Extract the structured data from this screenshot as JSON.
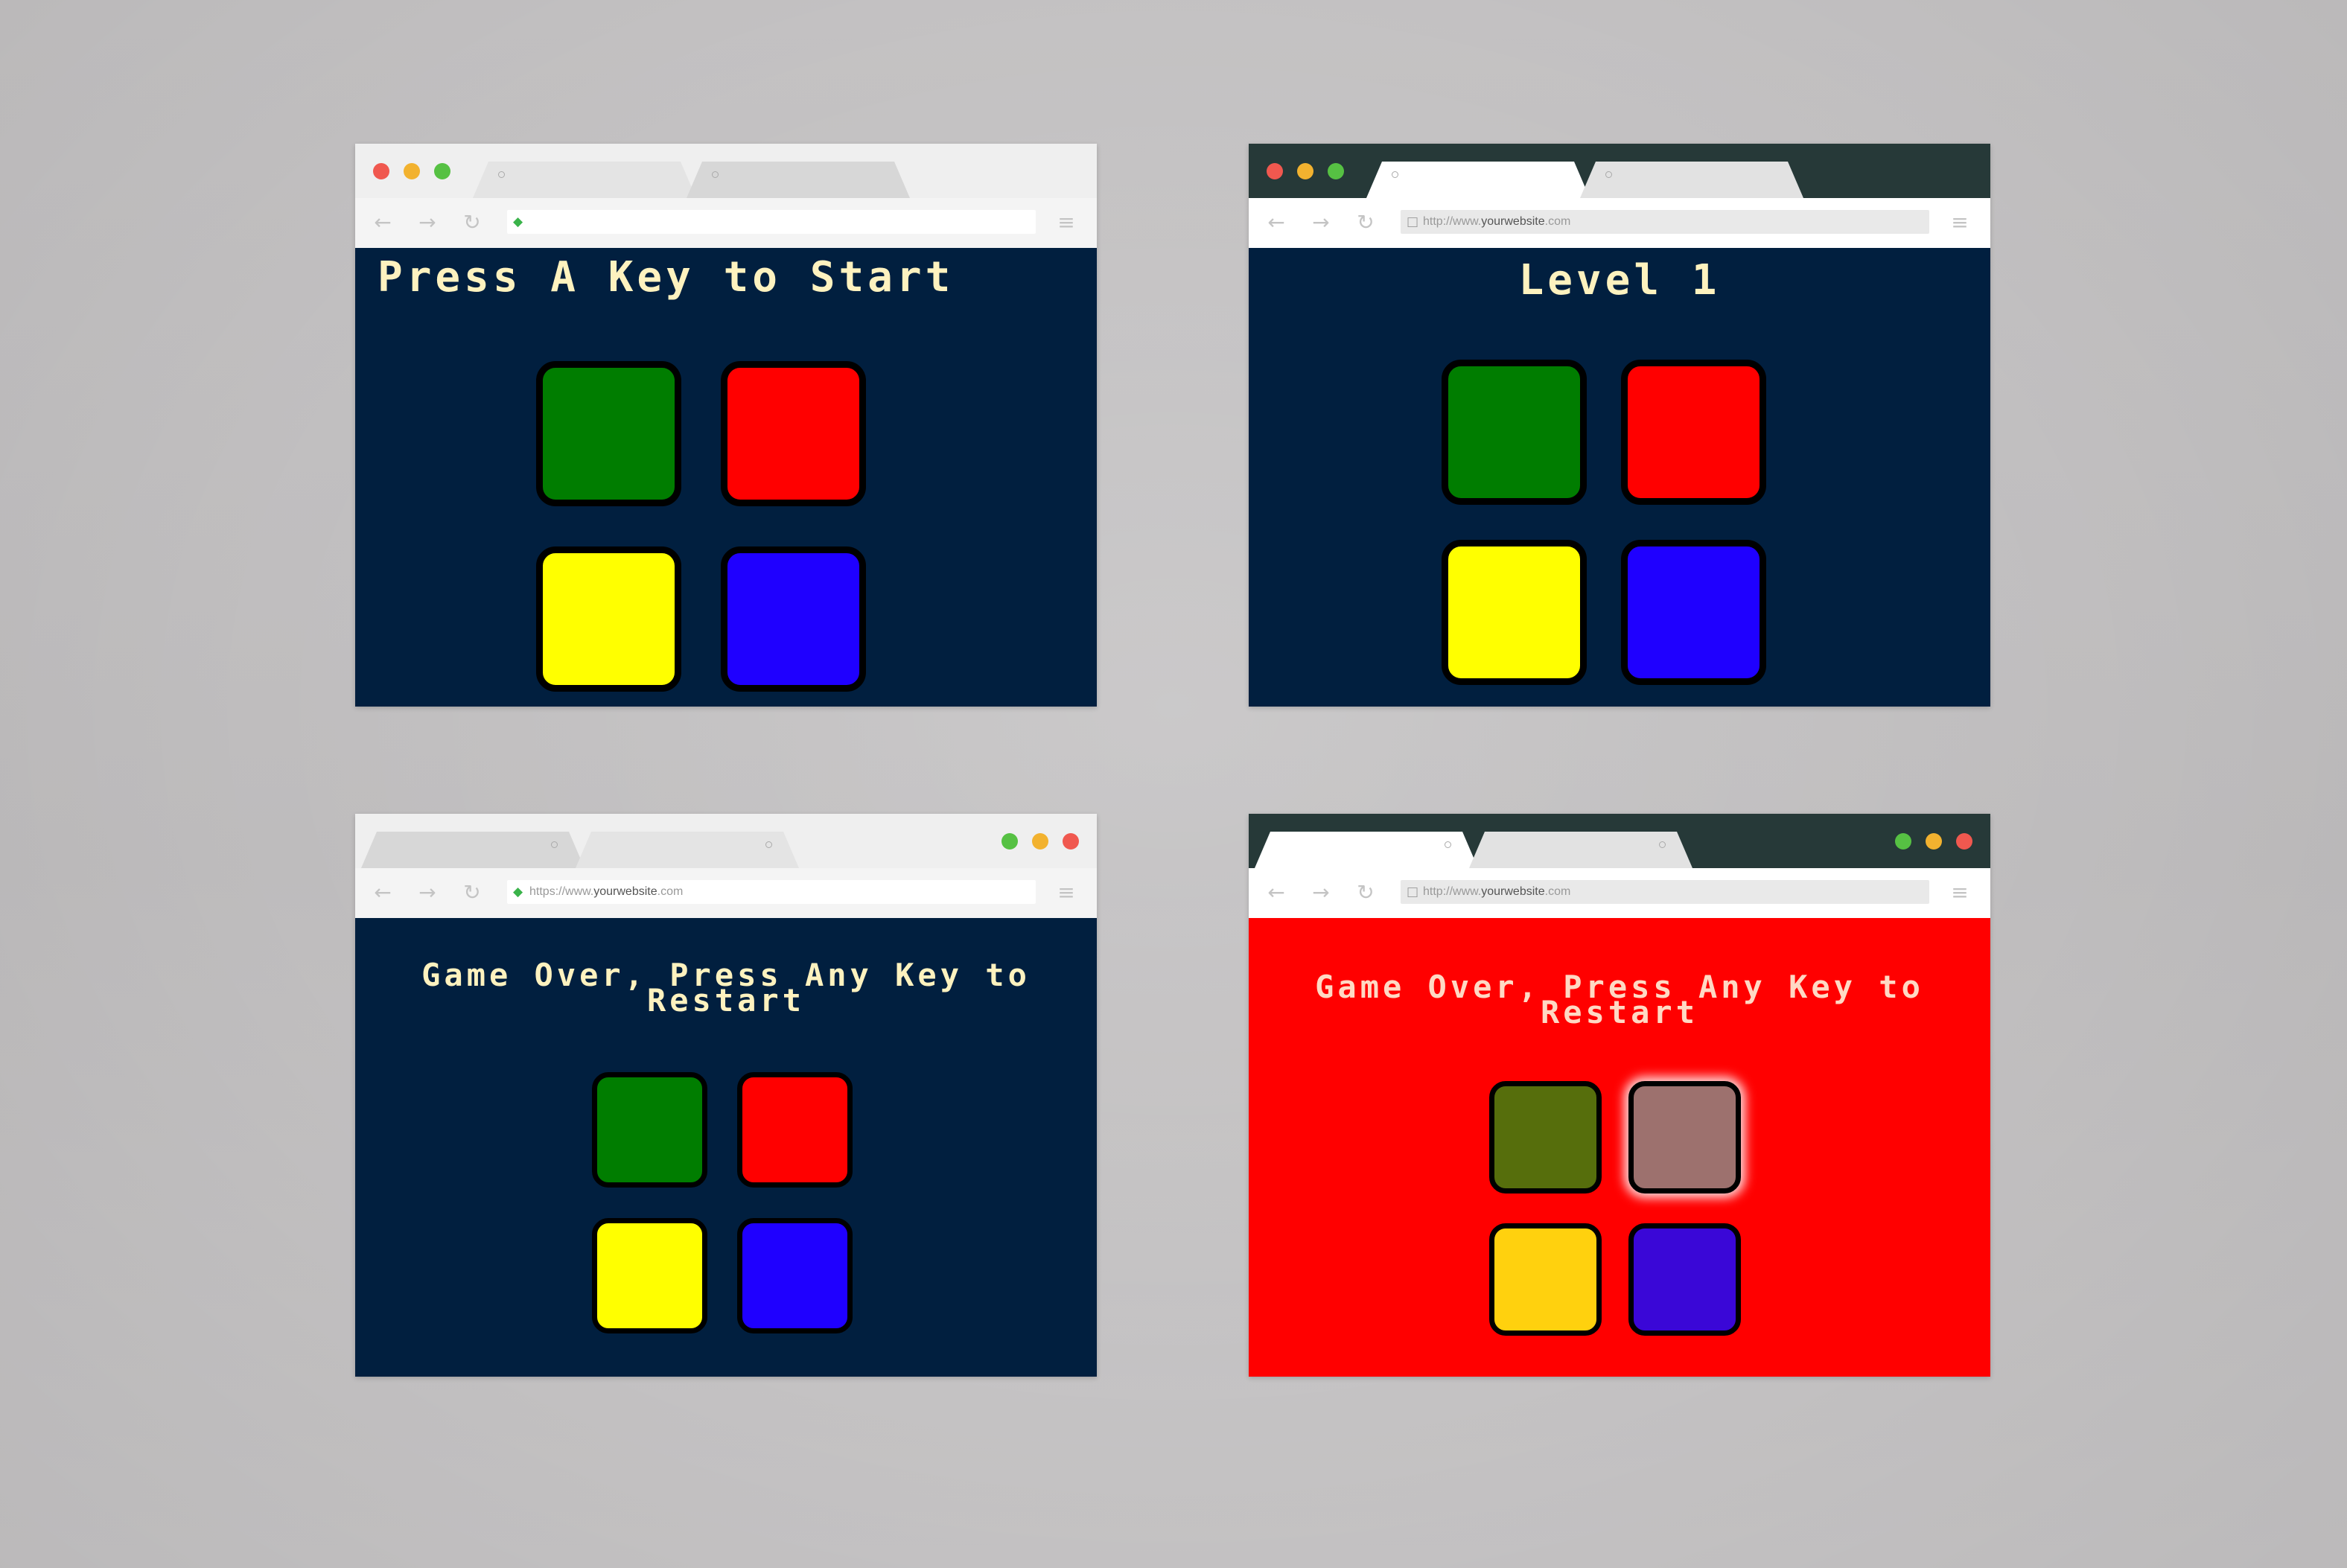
{
  "screens": {
    "start": {
      "address": {
        "url_plain": "",
        "url_bold": "",
        "url_suffix": ""
      },
      "title": "Press A Key to Start"
    },
    "level": {
      "address": {
        "url_plain": "http://www.",
        "url_bold": "yourwebsite",
        "url_suffix": ".com"
      },
      "title": "Level 1"
    },
    "gameover_dark": {
      "address": {
        "url_plain": "https://www.",
        "url_bold": "yourwebsite",
        "url_suffix": ".com"
      },
      "title_line1": "Game Over, Press Any Key to",
      "title_line2": "Restart"
    },
    "gameover_red": {
      "address": {
        "url_plain": "http://www.",
        "url_bold": "yourwebsite",
        "url_suffix": ".com"
      },
      "title_line1": "Game Over, Press Any Key to",
      "title_line2": "Restart"
    }
  },
  "icons": {
    "back": "←",
    "forward": "→",
    "reload": "↻",
    "menu": "≡",
    "lock": "🔒",
    "page": "□"
  },
  "colors": {
    "background_game": "#011f3f",
    "background_over": "#ff0000",
    "title_text": "#fef2bf",
    "pad_green": "#007d00",
    "pad_red": "#ff0000",
    "pad_yellow": "#ffff00",
    "pad_blue": "#1f00ff",
    "pad_green_over": "#566e0c",
    "pad_red_over": "#9d716e",
    "pad_yellow_over": "#ffd10e",
    "pad_blue_over": "#3a07d7"
  }
}
